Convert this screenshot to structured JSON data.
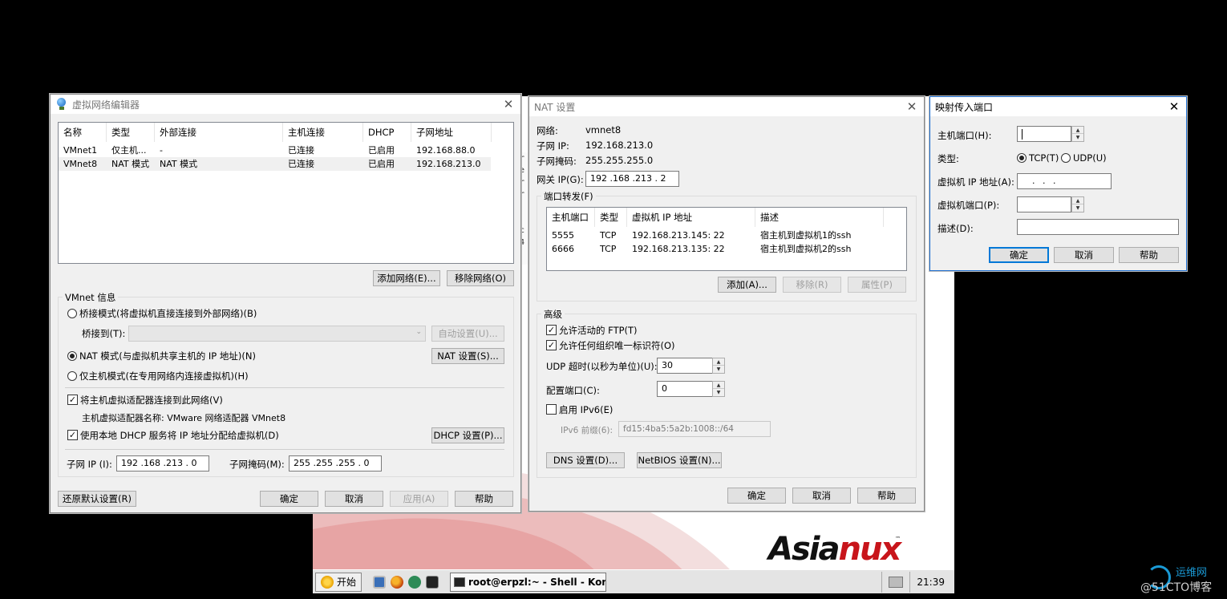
{
  "vnet_editor": {
    "title": "虚拟网络编辑器",
    "columns": [
      "名称",
      "类型",
      "外部连接",
      "主机连接",
      "DHCP",
      "子网地址"
    ],
    "rows": [
      [
        "VMnet1",
        "仅主机...",
        "-",
        "已连接",
        "已启用",
        "192.168.88.0"
      ],
      [
        "VMnet8",
        "NAT 模式",
        "NAT 模式",
        "已连接",
        "已启用",
        "192.168.213.0"
      ]
    ],
    "add_network": "添加网络(E)...",
    "remove_network": "移除网络(O)",
    "vmnet_info": "VMnet 信息",
    "bridge_mode": "桥接模式(将虚拟机直接连接到外部网络)(B)",
    "bridge_to": "桥接到(T):",
    "auto_settings": "自动设置(U)...",
    "nat_mode": "NAT 模式(与虚拟机共享主机的 IP 地址)(N)",
    "nat_settings": "NAT 设置(S)...",
    "host_only": "仅主机模式(在专用网络内连接虚拟机)(H)",
    "connect_adapter": "将主机虚拟适配器连接到此网络(V)",
    "adapter_name": "主机虚拟适配器名称: VMware 网络适配器 VMnet8",
    "use_dhcp": "使用本地 DHCP 服务将 IP 地址分配给虚拟机(D)",
    "dhcp_settings": "DHCP 设置(P)...",
    "subnet_ip_label": "子网 IP (I):",
    "subnet_ip": "192 .168 .213 .  0",
    "subnet_mask_label": "子网掩码(M):",
    "subnet_mask": "255 .255 .255 .  0",
    "restore": "还原默认设置(R)",
    "ok": "确定",
    "cancel": "取消",
    "apply": "应用(A)",
    "help": "帮助"
  },
  "nat": {
    "title": "NAT 设置",
    "network_label": "网络:",
    "network": "vmnet8",
    "subnet_ip_label": "子网 IP:",
    "subnet_ip": "192.168.213.0",
    "subnet_mask_label": "子网掩码:",
    "subnet_mask": "255.255.255.0",
    "gateway_label": "网关 IP(G):",
    "gateway": "192 .168 .213 .  2",
    "port_forward": "端口转发(F)",
    "columns": [
      "主机端口",
      "类型",
      "虚拟机 IP 地址",
      "描述"
    ],
    "rows": [
      [
        "5555",
        "TCP",
        "192.168.213.145: 22",
        "宿主机到虚拟机1的ssh"
      ],
      [
        "6666",
        "TCP",
        "192.168.213.135: 22",
        "宿主机到虚拟机2的ssh"
      ]
    ],
    "add": "添加(A)...",
    "remove": "移除(R)",
    "properties": "属性(P)",
    "advanced": "高级",
    "allow_ftp": "允许活动的 FTP(T)",
    "allow_oui": "允许任何组织唯一标识符(O)",
    "udp_timeout_label": "UDP 超时(以秒为单位)(U):",
    "udp_timeout": "30",
    "config_port_label": "配置端口(C):",
    "config_port": "0",
    "enable_ipv6": "启用 IPv6(E)",
    "ipv6_prefix_label": "IPv6 前缀(6):",
    "ipv6_prefix": "fd15:4ba5:5a2b:1008::/64",
    "dns_settings": "DNS 设置(D)...",
    "netbios_settings": "NetBIOS 设置(N)...",
    "ok": "确定",
    "cancel": "取消",
    "help": "帮助"
  },
  "map_port": {
    "title": "映射传入端口",
    "host_port_label": "主机端口(H):",
    "host_port": "",
    "type_label": "类型:",
    "tcp": "TCP(T)",
    "udp": "UDP(U)",
    "vm_ip_label": "虚拟机 IP 地址(A):",
    "vm_ip": ".   .   .",
    "vm_port_label": "虚拟机端口(P):",
    "vm_port": "",
    "desc_label": "描述(D):",
    "desc": "",
    "ok": "确定",
    "cancel": "取消",
    "help": "帮助"
  },
  "vm_desktop": {
    "logo_main": "Asia",
    "logo_ux": "nux",
    "logo_tm": "™",
    "term_chars": "cr\nle\ncr\ncr\n\ns\nec\n54",
    "start_label": "开始",
    "task_label": "root@erpzl:~ - Shell - Konsole",
    "clock": "21:39"
  },
  "watermark": {
    "text": "@51CTO博客",
    "site": "运维网"
  }
}
